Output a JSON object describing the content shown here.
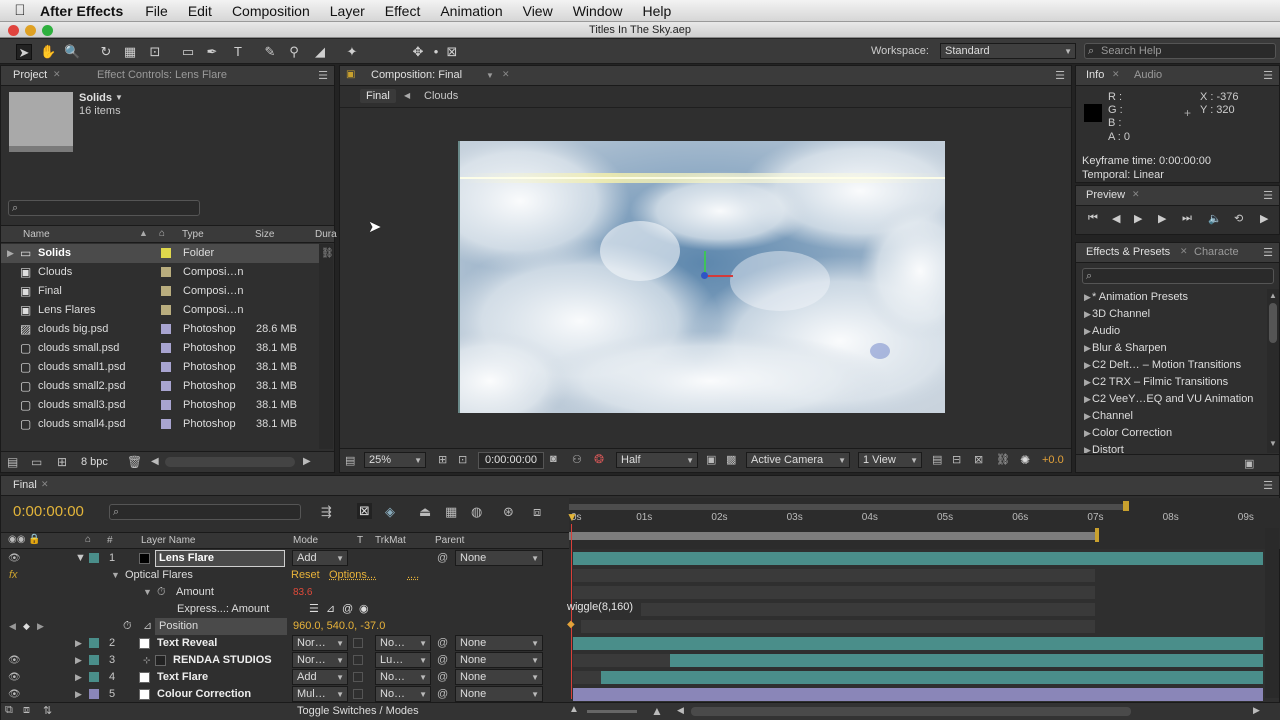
{
  "menubar": {
    "app_name": "After Effects",
    "items": [
      "File",
      "Edit",
      "Composition",
      "Layer",
      "Effect",
      "Animation",
      "View",
      "Window",
      "Help"
    ]
  },
  "window_title": "Titles In The Sky.aep",
  "toolbar": {
    "workspace_label": "Workspace:",
    "workspace_value": "Standard",
    "search_help": "Search Help"
  },
  "project_panel": {
    "tab_project": "Project",
    "tab_effect_controls": "Effect Controls: Lens Flare",
    "selected_name": "Solids",
    "selected_count": "16 items",
    "columns": {
      "name": "Name",
      "type": "Type",
      "size": "Size",
      "duration": "Dura"
    },
    "items": [
      {
        "name": "Solids",
        "type": "Folder",
        "size": "",
        "icon": "folder-icon",
        "label_color": "#e0d84c"
      },
      {
        "name": "Clouds",
        "type": "Composi…n",
        "size": "",
        "icon": "composition-icon",
        "label_color": "#b9ad7e"
      },
      {
        "name": "Final",
        "type": "Composi…n",
        "size": "",
        "icon": "composition-icon",
        "label_color": "#b9ad7e"
      },
      {
        "name": "Lens Flares",
        "type": "Composi…n",
        "size": "",
        "icon": "composition-icon",
        "label_color": "#b9ad7e"
      },
      {
        "name": "clouds big.psd",
        "type": "Photoshop",
        "size": "28.6 MB",
        "icon": "image-file-icon",
        "label_color": "#a8a4d0"
      },
      {
        "name": "clouds small.psd",
        "type": "Photoshop",
        "size": "38.1 MB",
        "icon": "psd-file-icon",
        "label_color": "#a8a4d0"
      },
      {
        "name": "clouds small1.psd",
        "type": "Photoshop",
        "size": "38.1 MB",
        "icon": "psd-file-icon",
        "label_color": "#a8a4d0"
      },
      {
        "name": "clouds small2.psd",
        "type": "Photoshop",
        "size": "38.1 MB",
        "icon": "psd-file-icon",
        "label_color": "#a8a4d0"
      },
      {
        "name": "clouds small3.psd",
        "type": "Photoshop",
        "size": "38.1 MB",
        "icon": "psd-file-icon",
        "label_color": "#a8a4d0"
      },
      {
        "name": "clouds small4.psd",
        "type": "Photoshop",
        "size": "38.1 MB",
        "icon": "psd-file-icon",
        "label_color": "#a8a4d0"
      }
    ],
    "bpc": "8 bpc"
  },
  "comp_panel": {
    "tab": "Composition: Final",
    "crumb_final": "Final",
    "crumb_clouds": "Clouds",
    "zoom": "25%",
    "timecode": "0:00:00:00",
    "resolution": "Half",
    "camera": "Active Camera",
    "views": "1 View",
    "exposure": "+0.0"
  },
  "info_panel": {
    "tab_info": "Info",
    "tab_audio": "Audio",
    "r": "R :",
    "g": "G :",
    "b": "B :",
    "a": "A : 0",
    "x": "X : -376",
    "y": "Y : 320",
    "keyframe_time": "Keyframe time: 0:00:00:00",
    "temporal": "Temporal: Linear"
  },
  "preview_panel": {
    "tab": "Preview"
  },
  "effects_panel": {
    "tab": "Effects & Presets",
    "tab2": "Characte",
    "items": [
      "* Animation Presets",
      "3D Channel",
      "Audio",
      "Blur & Sharpen",
      "C2 Delt… – Motion Transitions",
      "C2 TRX – Filmic Transitions",
      "C2 VeeY…EQ and VU Animation",
      "Channel",
      "Color Correction",
      "Distort"
    ]
  },
  "timeline": {
    "tab": "Final",
    "timecode": "0:00:00:00",
    "col_layer_name": "Layer Name",
    "col_mode": "Mode",
    "col_t": "T",
    "col_trkmat": "TrkMat",
    "col_parent": "Parent",
    "ruler": [
      "0s",
      "01s",
      "02s",
      "03s",
      "04s",
      "05s",
      "06s",
      "07s",
      "08s",
      "09s"
    ],
    "layer1": {
      "num": "1",
      "name": "Lens Flare",
      "mode": "Add",
      "parent": "None",
      "label_color": "#4a8e8a"
    },
    "optical_flares": "Optical Flares",
    "reset": "Reset",
    "options": "Options...",
    "dots": "....",
    "amount_label": "Amount",
    "amount_value": "83.6",
    "expression_label": "Express...: Amount",
    "expression": "wiggle(8,160)",
    "position_label": "Position",
    "position_value": "960.0, 540.0, -37.0",
    "layers": [
      {
        "num": "2",
        "name": "Text Reveal",
        "mode": "Nor…",
        "trkmat": "No…",
        "parent": "None",
        "label_color": "#4a8e8a",
        "bar_start": 0.0
      },
      {
        "num": "3",
        "name": "RENDAA STUDIOS",
        "mode": "Nor…",
        "trkmat": "Lu…",
        "parent": "None",
        "label_color": "#4a8e8a",
        "bar_start": 0.14
      },
      {
        "num": "4",
        "name": "Text Flare",
        "mode": "Add",
        "trkmat": "No…",
        "parent": "None",
        "label_color": "#4a8e8a",
        "bar_start": 0.04
      },
      {
        "num": "5",
        "name": "Colour Correction",
        "mode": "Mul…",
        "trkmat": "No…",
        "parent": "None",
        "label_color": "#8a86b8",
        "bar_start": 0.0
      }
    ],
    "toggle_label": "Toggle Switches / Modes"
  }
}
